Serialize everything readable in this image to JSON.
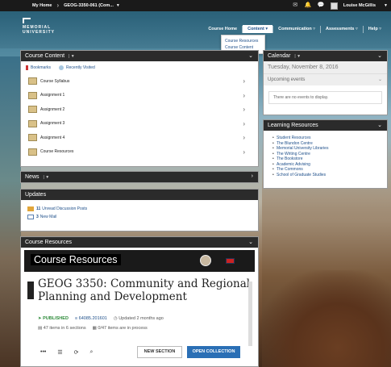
{
  "topbar": {
    "home": "My Home",
    "course": "GEOG-3350-061 (Com...",
    "user": "Louise McGillis"
  },
  "logo": {
    "line1": "MEMORIAL",
    "line2": "UNIVERSITY"
  },
  "nav": {
    "items": [
      "Course Home",
      "Content ▾",
      "Communication ▿",
      "Assessments ▿",
      "Help ▿"
    ],
    "dropdown": [
      "Course Resources",
      "Course Content"
    ]
  },
  "course_content": {
    "title": "Course Content",
    "tabs": [
      "Bookmarks",
      "Recently Visited"
    ],
    "items": [
      "Course Syllabus",
      "Assignment 1",
      "Assignment 2",
      "Assignment 3",
      "Assignment 4",
      "Course Resources"
    ]
  },
  "calendar": {
    "title": "Calendar",
    "date": "Tuesday, November 8, 2016",
    "upcoming": "Upcoming events",
    "empty": "There are no events to display."
  },
  "learning_resources": {
    "title": "Learning Resources",
    "links": [
      "Student Resources",
      "The Blundon Centre",
      "Memorial University Libraries",
      "The Writing Centre",
      "The Bookstore",
      "Academic Advising",
      "The Commons",
      "School of Graduate Studies"
    ]
  },
  "news": {
    "title": "News"
  },
  "updates": {
    "title": "Updates",
    "items": [
      {
        "count": "11",
        "label": "Unread Discussion Posts"
      },
      {
        "count": "3",
        "label": "New Mail"
      }
    ]
  },
  "course_resources": {
    "title": "Course Resources",
    "banner": "Course Resources",
    "heading": "GEOG 3350: Community and Regional Planning and Development",
    "status": "PUBLISHED",
    "course_id": "64085.201601",
    "updated": "Updated 2 months ago",
    "items_count": "47 items in 6 sections",
    "progress": "0/47 items are in process",
    "new_section": "NEW SECTION",
    "open_collection": "OPEN COLLECTION"
  }
}
